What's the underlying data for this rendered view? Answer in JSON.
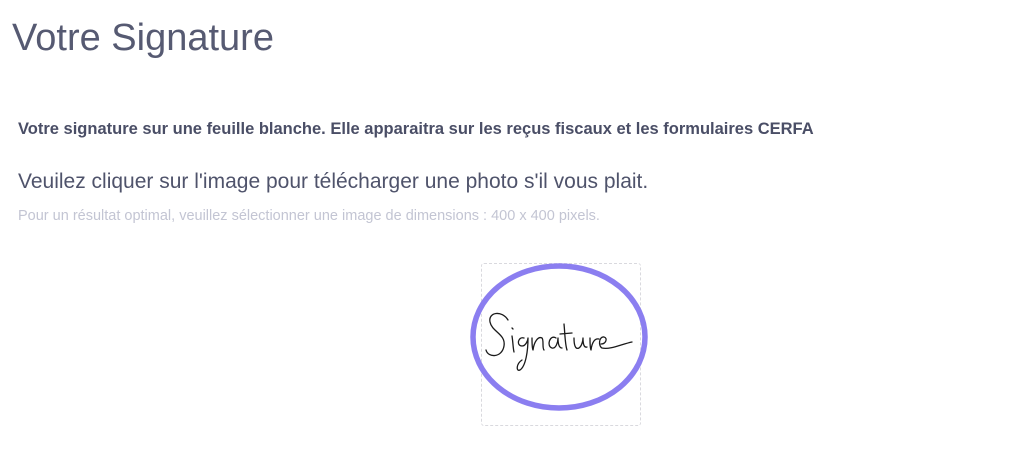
{
  "page": {
    "title": "Votre Signature"
  },
  "signature_section": {
    "heading": "Votre signature sur une feuille blanche. Elle apparaitra sur les reçus fiscaux et les formulaires CERFA",
    "instruction": "Veuilez cliquer sur l'image pour télécharger une photo s'il vous plait.",
    "hint": "Pour un résultat optimal, veuillez sélectionner une image de dimensions : 400 x 400 pixels.",
    "image_text": "Signature",
    "ring_color": "#8b7ef0"
  }
}
